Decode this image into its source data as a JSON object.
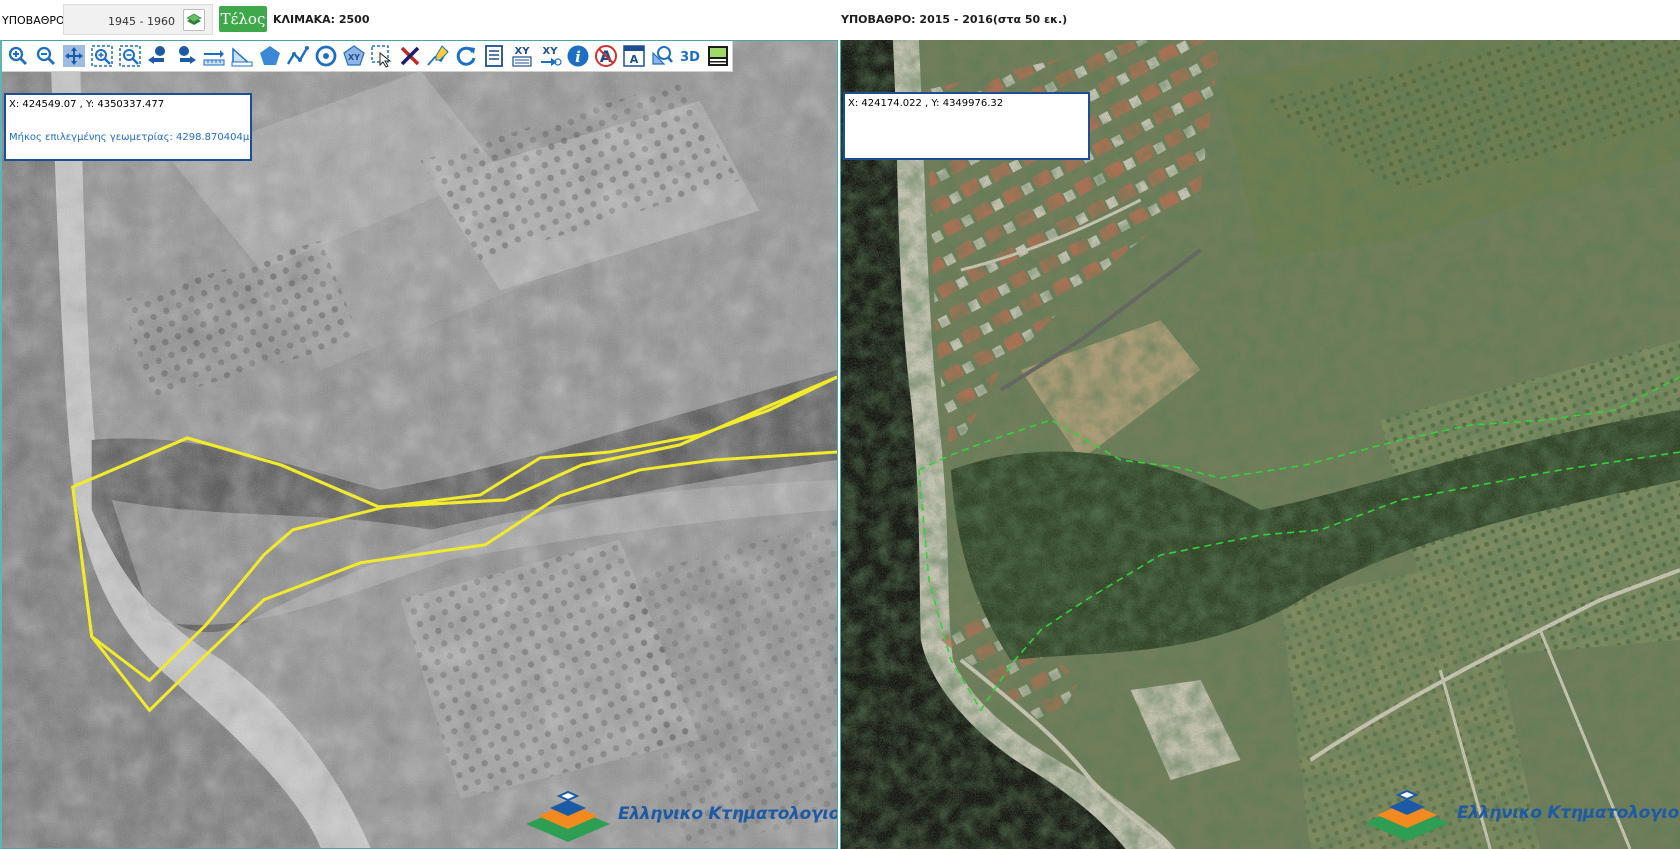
{
  "header": {
    "base_label": "ΥΠΟΒΑΘΡΟ:",
    "year_range": "1945 - 1960",
    "end_button": "Τέλος",
    "scale_label": "ΚΛΙΜΑΚΑ: 2500",
    "right_title": "ΥΠΟΒΑΘΡΟ: 2015 - 2016(στα 50 εκ.)"
  },
  "toolbar": {
    "tools": [
      "zoom-in-icon",
      "zoom-out-icon",
      "pan-icon",
      "zoom-box-in-icon",
      "zoom-box-out-icon",
      "previous-extent-icon",
      "next-extent-icon",
      "measure-length-icon",
      "measure-area-icon",
      "draw-polygon-icon",
      "draw-polyline-icon",
      "circle-icon",
      "xy-polygon-icon",
      "select-icon",
      "clear-icon",
      "edit-vertices-icon",
      "refresh-icon",
      "report-icon",
      "xy-list-icon",
      "xy-goto-icon",
      "info-icon",
      "no-label-icon",
      "text-label-icon",
      "search-area-icon",
      "3d-icon",
      "print-icon"
    ],
    "label_3d": "3D"
  },
  "left_panel": {
    "coords": "X: 424549.07 , Y: 4350337.477",
    "measure": "Μήκος επιλεγμένης γεωμετρίας: 4298.870404μ.",
    "logo_text": "Ελληνικο Κτηματολογιο"
  },
  "right_panel": {
    "coords": "X: 424174.022 , Y: 4349976.32",
    "logo_text": "Ελληνικο Κτηματολογιο"
  },
  "colors": {
    "accent_green": "#3fa84a",
    "polygon_yellow": "#f2ea2c",
    "polygon_green_dashed": "#33d13a",
    "infobox_border": "#1b4e95",
    "measure_text": "#1f6cc8",
    "logo_blue": "#1d5aa6"
  }
}
